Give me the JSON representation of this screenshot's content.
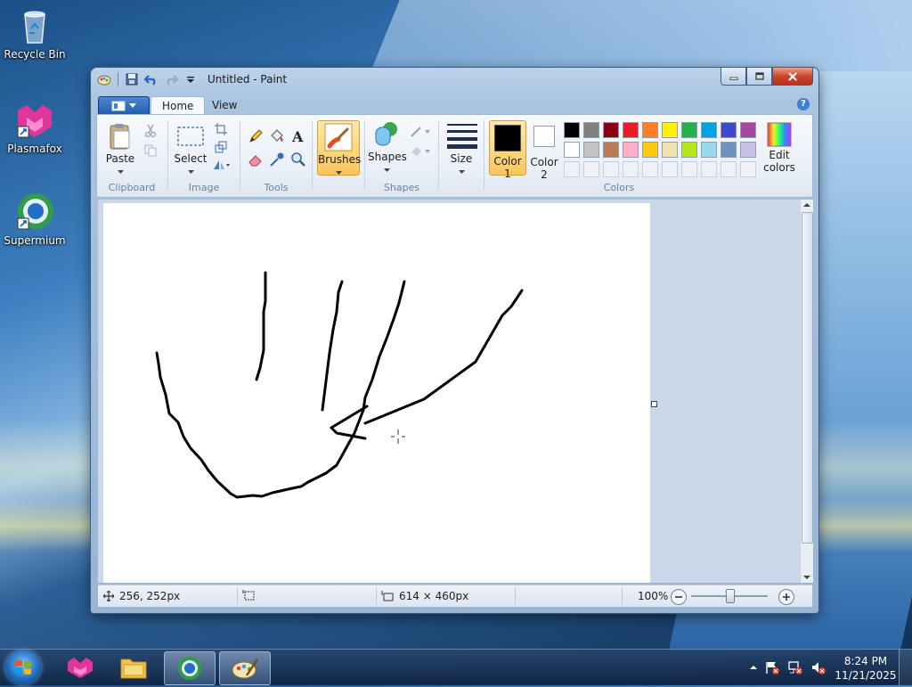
{
  "desktop": {
    "icons": [
      {
        "label": "Recycle Bin"
      },
      {
        "label": "Plasmafox"
      },
      {
        "label": "Supermium"
      }
    ]
  },
  "window": {
    "title": "Untitled - Paint",
    "controls": {
      "minimize": "minimize",
      "maximize": "maximize",
      "close": "close"
    }
  },
  "ribbon": {
    "tabs": [
      {
        "label": "Home",
        "selected": true
      },
      {
        "label": "View",
        "selected": false
      }
    ],
    "groups": {
      "clipboard": {
        "label": "Clipboard",
        "paste": "Paste"
      },
      "image": {
        "label": "Image",
        "select": "Select"
      },
      "tools": {
        "label": "Tools"
      },
      "brushes": {
        "label": "Brushes"
      },
      "shapes": {
        "label": "Shapes",
        "button": "Shapes"
      },
      "size": {
        "label": "Size"
      },
      "colors": {
        "label": "Colors",
        "color1": "Color",
        "color1_num": "1",
        "color2": "Color",
        "color2_num": "2",
        "edit_colors_1": "Edit",
        "edit_colors_2": "colors",
        "color1_value": "#000000",
        "color2_value": "#ffffff",
        "palette_row1": [
          "#000000",
          "#7f7f7f",
          "#880015",
          "#ed1c24",
          "#ff7f27",
          "#fff200",
          "#22b14c",
          "#00a2e8",
          "#3f48cc",
          "#a349a4"
        ],
        "palette_row2": [
          "#ffffff",
          "#c3c3c3",
          "#b97a57",
          "#ffaec9",
          "#ffc90e",
          "#efe4b0",
          "#b5e61d",
          "#99d9ea",
          "#7092be",
          "#c8bfe7"
        ]
      }
    }
  },
  "status": {
    "cursor_pos": "256, 252px",
    "image_size": "614 × 460px",
    "zoom": "100%",
    "zoom_slider_value": 0.5
  },
  "taskbar": {
    "apps": [
      "start",
      "plasmafox",
      "explorer",
      "supermium",
      "paint"
    ],
    "clock_time": "8:24 PM",
    "clock_date": "11/21/2025"
  }
}
